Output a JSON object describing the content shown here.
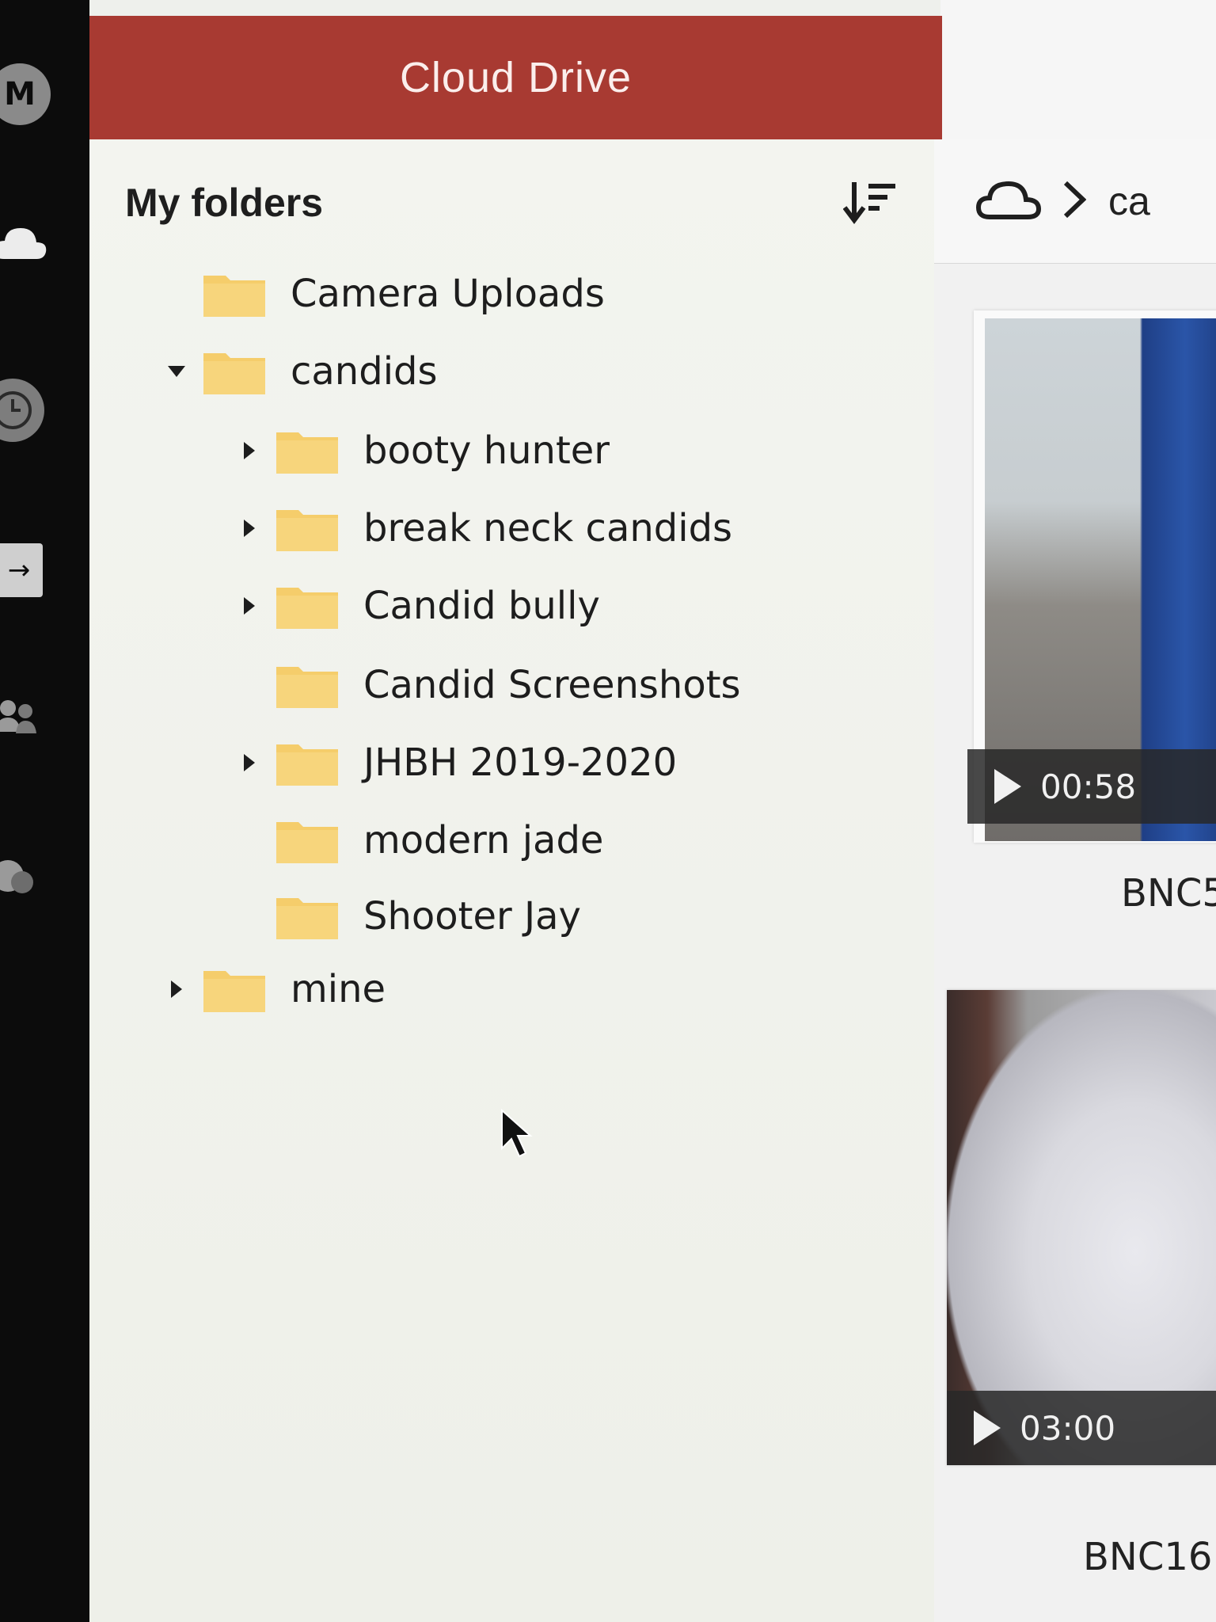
{
  "header": {
    "title": "Cloud Drive"
  },
  "panel": {
    "title": "My folders",
    "sort_icon": "sort-descending-icon",
    "folders": [
      {
        "label": "Camera Uploads",
        "expander": "none"
      },
      {
        "label": "candids",
        "expander": "expanded"
      },
      {
        "label": "booty hunter",
        "expander": "collapsed"
      },
      {
        "label": "break neck candids",
        "expander": "collapsed"
      },
      {
        "label": "Candid bully",
        "expander": "collapsed"
      },
      {
        "label": "Candid Screenshots",
        "expander": "none"
      },
      {
        "label": "JHBH 2019-2020",
        "expander": "collapsed"
      },
      {
        "label": "modern jade",
        "expander": "none"
      },
      {
        "label": "Shooter Jay",
        "expander": "none"
      },
      {
        "label": "mine",
        "expander": "collapsed"
      }
    ]
  },
  "breadcrumb": {
    "root_icon": "cloud-icon",
    "current": "ca"
  },
  "files": [
    {
      "duration": "00:58",
      "name": "BNC5"
    },
    {
      "duration": "03:00",
      "name": "BNC16."
    }
  ],
  "colors": {
    "header": "#a83a32",
    "folder": "#f5cd6b",
    "rail": "#0c0c0c"
  },
  "rail_icons": [
    "mega-logo-icon",
    "cloud-icon",
    "clock-icon",
    "transfer-icon",
    "contacts-icon",
    "chat-icon"
  ]
}
